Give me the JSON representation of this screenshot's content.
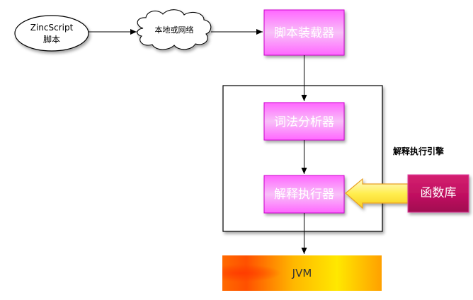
{
  "nodes": {
    "source": {
      "line1": "ZincScript",
      "line2": "脚本"
    },
    "cloud": {
      "label": "本地或网络"
    },
    "loader": {
      "label": "脚本装载器"
    },
    "lexer": {
      "label": "词法分析器"
    },
    "executor": {
      "label": "解释执行器"
    },
    "library": {
      "label": "函数库"
    },
    "jvm": {
      "label": "JVM"
    },
    "engine": {
      "label": "解释执行引擎"
    }
  },
  "colors": {
    "magenta_box": "#f2a0f2",
    "magenta_border": "#cc00cc",
    "library_fill": "#c0165c",
    "library_border": "#e040a0",
    "block_arrow_fill": "#fff060",
    "block_arrow_stroke": "#e8a020",
    "jvm_gradient": [
      "#ff5a00",
      "#ffd000",
      "#ffe800",
      "#ff9a00"
    ]
  }
}
